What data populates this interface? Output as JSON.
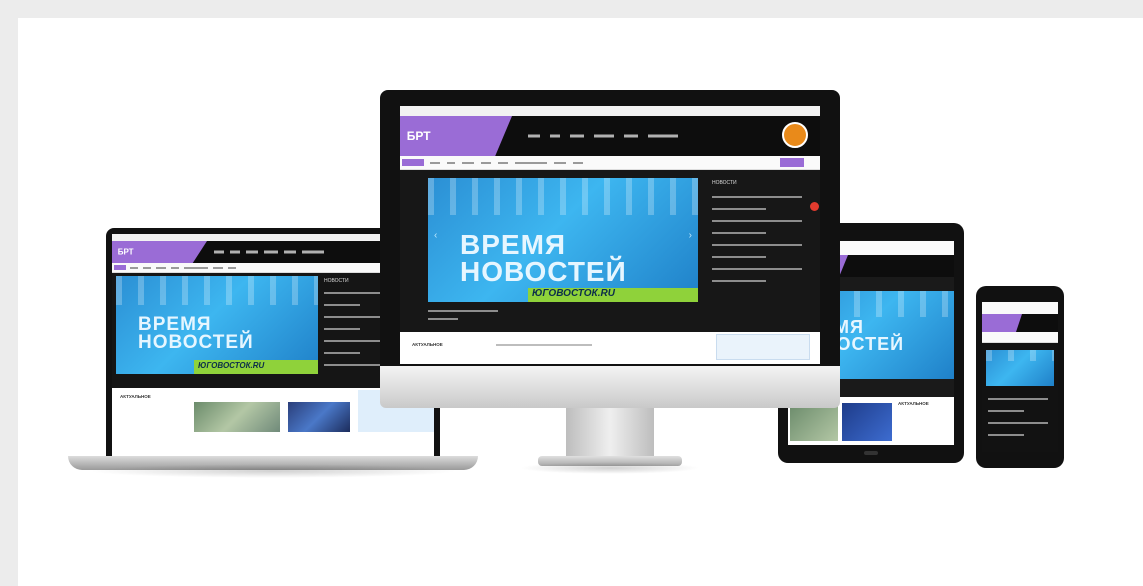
{
  "site": {
    "logo_text": "БРТ",
    "hero_line1": "ВРЕМЯ",
    "hero_line2": "НОВОСТЕЙ",
    "hero_caption": "ЮГОВОСТОК.RU",
    "sidebar_heading": "НОВОСТИ",
    "section_label": "АКТУАЛЬНОЕ"
  },
  "colors": {
    "accent": "#9a6cd6",
    "hero_blue": "#2b8fd4",
    "hero_green": "#8fd23a",
    "badge_orange": "#e98a1a"
  },
  "devices": [
    "desktop-monitor",
    "laptop",
    "tablet",
    "smartphone"
  ]
}
